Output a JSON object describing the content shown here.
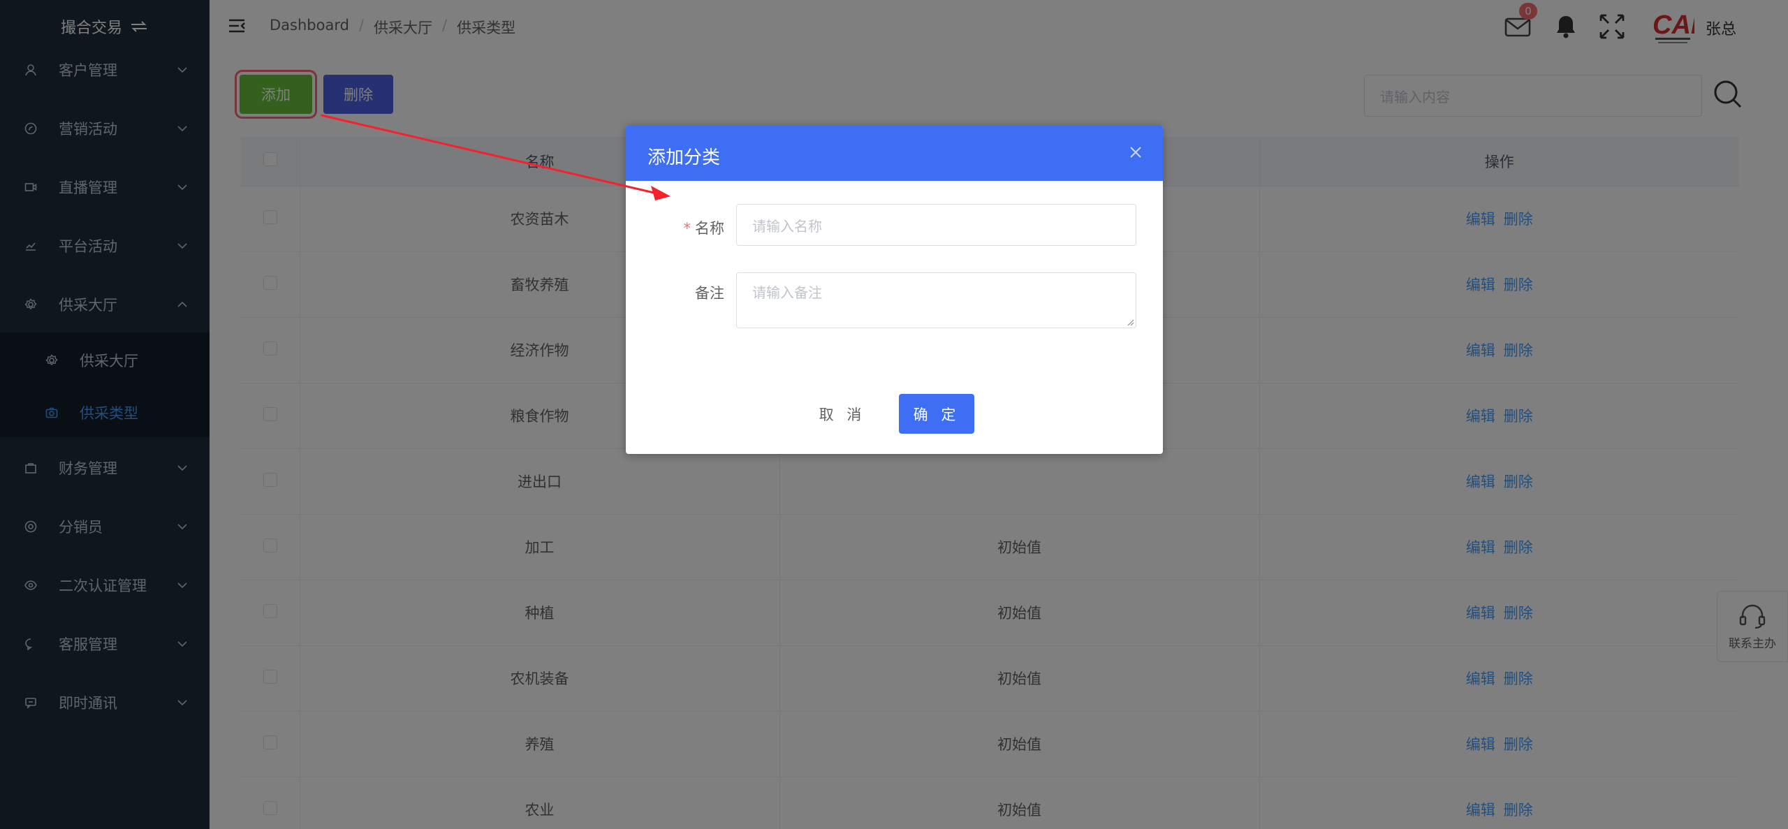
{
  "sidebar": {
    "brand": "撮合交易",
    "items": [
      {
        "label": "客户管理",
        "icon": "user-icon"
      },
      {
        "label": "营销活动",
        "icon": "compass-icon"
      },
      {
        "label": "直播管理",
        "icon": "video-icon"
      },
      {
        "label": "平台活动",
        "icon": "chart-icon"
      },
      {
        "label": "供采大厅",
        "icon": "gear-icon",
        "expanded": true
      },
      {
        "label": "财务管理",
        "icon": "bag-icon"
      },
      {
        "label": "分销员",
        "icon": "settings-icon"
      },
      {
        "label": "二次认证管理",
        "icon": "eye-icon"
      },
      {
        "label": "客服管理",
        "icon": "chat-icon"
      },
      {
        "label": "即时通讯",
        "icon": "message-icon"
      }
    ],
    "subitems": [
      {
        "label": "供采大厅",
        "icon": "gear-icon"
      },
      {
        "label": "供采类型",
        "icon": "camera-icon",
        "active": true
      }
    ]
  },
  "header": {
    "breadcrumb": [
      "Dashboard",
      "供采大厅",
      "供采类型"
    ],
    "mail_badge": "0",
    "logo_text": "CAF",
    "username": "张总"
  },
  "toolbar": {
    "add_label": "添加",
    "delete_label": "删除",
    "search_placeholder": "请输入内容"
  },
  "table": {
    "columns": [
      "名称",
      "",
      "操作"
    ],
    "rows": [
      {
        "name": "农资苗木",
        "remark": ""
      },
      {
        "name": "畜牧养殖",
        "remark": ""
      },
      {
        "name": "经济作物",
        "remark": ""
      },
      {
        "name": "粮食作物",
        "remark": ""
      },
      {
        "name": "进出口",
        "remark": ""
      },
      {
        "name": "加工",
        "remark": "初始值"
      },
      {
        "name": "种植",
        "remark": "初始值"
      },
      {
        "name": "农机装备",
        "remark": "初始值"
      },
      {
        "name": "养殖",
        "remark": "初始值"
      },
      {
        "name": "农业",
        "remark": "初始值"
      }
    ],
    "edit_label": "编辑",
    "delete_label": "删除"
  },
  "service": {
    "label": "联系主办"
  },
  "dialog": {
    "title": "添加分类",
    "name_label": "名称",
    "name_placeholder": "请输入名称",
    "remark_label": "备注",
    "remark_placeholder": "请输入备注",
    "cancel_label": "取 消",
    "ok_label": "确 定"
  },
  "colors": {
    "sidebar_bg": "#1f2d3d",
    "primary": "#3e6ef3",
    "success": "#67c23a",
    "danger": "#f56c6c",
    "link": "#409eff",
    "annotation": "#f5222d"
  }
}
